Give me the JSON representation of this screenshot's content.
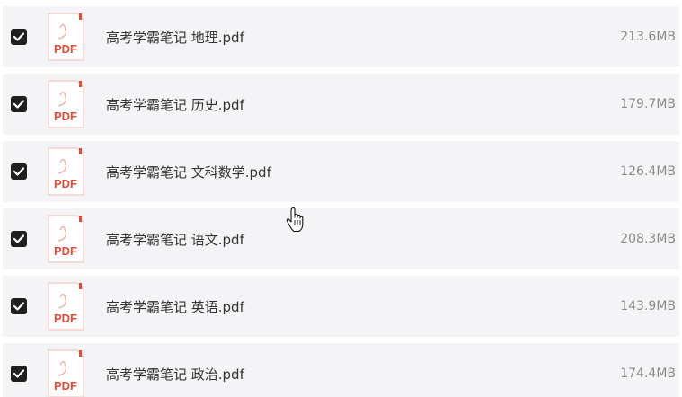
{
  "files": [
    {
      "name": "高考学霸笔记 地理.pdf",
      "size": "213.6MB",
      "checked": true
    },
    {
      "name": "高考学霸笔记 历史.pdf",
      "size": "179.7MB",
      "checked": true
    },
    {
      "name": "高考学霸笔记 文科数学.pdf",
      "size": "126.4MB",
      "checked": true
    },
    {
      "name": "高考学霸笔记 语文.pdf",
      "size": "208.3MB",
      "checked": true
    },
    {
      "name": "高考学霸笔记 英语.pdf",
      "size": "143.9MB",
      "checked": true
    },
    {
      "name": "高考学霸笔记 政治.pdf",
      "size": "174.4MB",
      "checked": true
    }
  ],
  "icon": {
    "type": "pdf-file-icon",
    "label": "PDF",
    "accent": "#e04b3a"
  },
  "colors": {
    "row_bg": "#f4f4f7",
    "checkbox": "#1f1f1f",
    "size_text": "#8a8a8a"
  }
}
